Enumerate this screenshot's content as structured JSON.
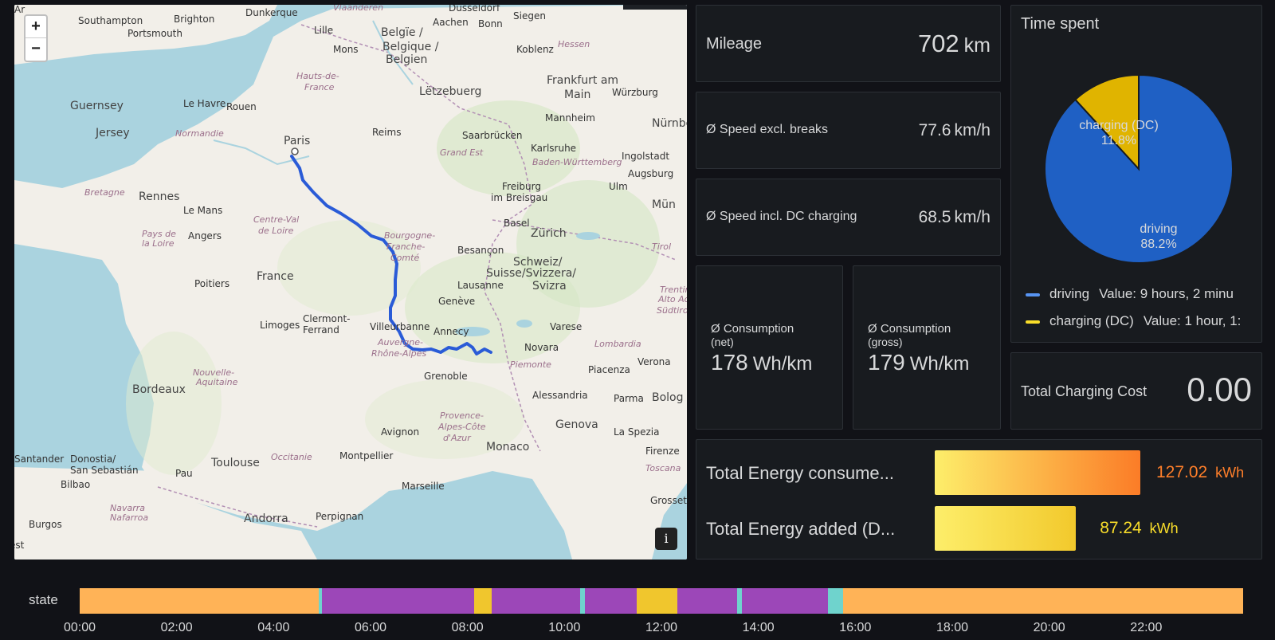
{
  "map": {
    "zoom_in_label": "+",
    "zoom_out_label": "−",
    "info_label": "i",
    "places": [
      {
        "name": "Southampton",
        "cls": ""
      },
      {
        "name": "Brighton",
        "cls": ""
      },
      {
        "name": "Portsmouth",
        "cls": ""
      },
      {
        "name": "Dunkerque",
        "cls": ""
      },
      {
        "name": "Vlaanderen",
        "cls": "region"
      },
      {
        "name": "Düsseldorf",
        "cls": ""
      },
      {
        "name": "Siegen",
        "cls": ""
      },
      {
        "name": "Hessen",
        "cls": "region"
      },
      {
        "name": "Lille",
        "cls": ""
      },
      {
        "name": "Aachen",
        "cls": ""
      },
      {
        "name": "Bonn",
        "cls": ""
      },
      {
        "name": "Mons",
        "cls": ""
      },
      {
        "name": "Belgïe /",
        "cls": "big"
      },
      {
        "name": "Belgique /",
        "cls": "big"
      },
      {
        "name": "Belgien",
        "cls": "big"
      },
      {
        "name": "Koblenz",
        "cls": ""
      },
      {
        "name": "Würzburg",
        "cls": ""
      },
      {
        "name": "Frankfurt am",
        "cls": "big"
      },
      {
        "name": "Main",
        "cls": "big"
      },
      {
        "name": "Guernsey",
        "cls": "big"
      },
      {
        "name": "Le Havre",
        "cls": ""
      },
      {
        "name": "Rouen",
        "cls": ""
      },
      {
        "name": "Hauts-de-",
        "cls": "region"
      },
      {
        "name": "France",
        "cls": "region"
      },
      {
        "name": "Lëtzebuerg",
        "cls": "big"
      },
      {
        "name": "Mannheim",
        "cls": ""
      },
      {
        "name": "Nürnber",
        "cls": "big"
      },
      {
        "name": "Jersey",
        "cls": "big"
      },
      {
        "name": "Normandie",
        "cls": "region"
      },
      {
        "name": "Paris",
        "cls": "big"
      },
      {
        "name": "Reims",
        "cls": ""
      },
      {
        "name": "Saarbrücken",
        "cls": ""
      },
      {
        "name": "Karlsruhe",
        "cls": ""
      },
      {
        "name": "Ingolstadt",
        "cls": ""
      },
      {
        "name": "Grand Est",
        "cls": "region"
      },
      {
        "name": "Baden-Württemberg",
        "cls": "region"
      },
      {
        "name": "Augsburg",
        "cls": ""
      },
      {
        "name": "Bretagne",
        "cls": "region"
      },
      {
        "name": "Rennes",
        "cls": "big"
      },
      {
        "name": "Freiburg",
        "cls": ""
      },
      {
        "name": "im Breisgau",
        "cls": ""
      },
      {
        "name": "Ulm",
        "cls": ""
      },
      {
        "name": "Mün",
        "cls": "big"
      },
      {
        "name": "Le Mans",
        "cls": ""
      },
      {
        "name": "Centre-Val",
        "cls": "region"
      },
      {
        "name": "de Loire",
        "cls": "region"
      },
      {
        "name": "Pays de",
        "cls": "region"
      },
      {
        "name": "la Loire",
        "cls": "region"
      },
      {
        "name": "Angers",
        "cls": ""
      },
      {
        "name": "Bourgogne-",
        "cls": "region"
      },
      {
        "name": "Franche-",
        "cls": "region"
      },
      {
        "name": "Comté",
        "cls": "region"
      },
      {
        "name": "Basel",
        "cls": ""
      },
      {
        "name": "Zürich",
        "cls": "big"
      },
      {
        "name": "Besançon",
        "cls": ""
      },
      {
        "name": "Schweiz/",
        "cls": "big"
      },
      {
        "name": "Suisse/Svizzera/",
        "cls": "big"
      },
      {
        "name": "Svizra",
        "cls": "big"
      },
      {
        "name": "Tirol",
        "cls": "region"
      },
      {
        "name": "Poitiers",
        "cls": ""
      },
      {
        "name": "France",
        "cls": "big"
      },
      {
        "name": "Lausanne",
        "cls": ""
      },
      {
        "name": "Trentino-",
        "cls": "region"
      },
      {
        "name": "Alto Adige",
        "cls": "region"
      },
      {
        "name": "Südtirol",
        "cls": "region"
      },
      {
        "name": "Genève",
        "cls": ""
      },
      {
        "name": "Limoges",
        "cls": ""
      },
      {
        "name": "Clermont-",
        "cls": ""
      },
      {
        "name": "Ferrand",
        "cls": ""
      },
      {
        "name": "Villeurbanne",
        "cls": ""
      },
      {
        "name": "Annecy",
        "cls": ""
      },
      {
        "name": "Varese",
        "cls": ""
      },
      {
        "name": "Lombardia",
        "cls": "region"
      },
      {
        "name": "Auvergne-",
        "cls": "region"
      },
      {
        "name": "Rhône-Alpes",
        "cls": "region"
      },
      {
        "name": "Novara",
        "cls": ""
      },
      {
        "name": "Verona",
        "cls": ""
      },
      {
        "name": "Piemonte",
        "cls": "region"
      },
      {
        "name": "Piacenza",
        "cls": ""
      },
      {
        "name": "Nouvelle-",
        "cls": "region"
      },
      {
        "name": "Aquitaine",
        "cls": "region"
      },
      {
        "name": "Grenoble",
        "cls": ""
      },
      {
        "name": "Bordeaux",
        "cls": "big"
      },
      {
        "name": "Alessandria",
        "cls": ""
      },
      {
        "name": "Parma",
        "cls": ""
      },
      {
        "name": "Bolog",
        "cls": "big"
      },
      {
        "name": "Provence-",
        "cls": "region"
      },
      {
        "name": "Alpes-Côte",
        "cls": "region"
      },
      {
        "name": "d'Azur",
        "cls": "region"
      },
      {
        "name": "Genova",
        "cls": "big"
      },
      {
        "name": "Avignon",
        "cls": ""
      },
      {
        "name": "La Spezia",
        "cls": ""
      },
      {
        "name": "Santander",
        "cls": ""
      },
      {
        "name": "Donostia/",
        "cls": ""
      },
      {
        "name": "San Sebastián",
        "cls": ""
      },
      {
        "name": "Toulouse",
        "cls": "big"
      },
      {
        "name": "Occitanie",
        "cls": "region"
      },
      {
        "name": "Montpellier",
        "cls": ""
      },
      {
        "name": "Monaco",
        "cls": "big"
      },
      {
        "name": "Firenze",
        "cls": ""
      },
      {
        "name": "Pau",
        "cls": ""
      },
      {
        "name": "Toscana",
        "cls": "region"
      },
      {
        "name": "Bilbao",
        "cls": ""
      },
      {
        "name": "Marseille",
        "cls": ""
      },
      {
        "name": "Grosseto",
        "cls": ""
      },
      {
        "name": "Navarra",
        "cls": "region"
      },
      {
        "name": "Nafarroa",
        "cls": "region"
      },
      {
        "name": "Andorra",
        "cls": "big"
      },
      {
        "name": "Perpignan",
        "cls": ""
      },
      {
        "name": "Burgos",
        "cls": ""
      },
      {
        "name": "est",
        "cls": ""
      },
      {
        "name": "Ar",
        "cls": ""
      }
    ]
  },
  "mileage": {
    "label": "Mileage",
    "value": "702",
    "unit": "km"
  },
  "speed_excl": {
    "label": "Ø Speed excl. breaks",
    "value": "77.6",
    "unit": "km/h"
  },
  "speed_incl": {
    "label": "Ø Speed incl. DC charging",
    "value": "68.5",
    "unit": "km/h"
  },
  "consumption_net": {
    "label_line1": "Ø Consumption",
    "label_line2": "(net)",
    "value": "178",
    "unit": "Wh/km"
  },
  "consumption_gross": {
    "label_line1": "Ø Consumption",
    "label_line2": "(gross)",
    "value": "179",
    "unit": "Wh/km"
  },
  "time_spent": {
    "title": "Time spent",
    "slices": [
      {
        "name": "driving",
        "percent_label": "88.2%",
        "fraction": 0.882,
        "color": "#1f60c4"
      },
      {
        "name": "charging (DC)",
        "percent_label": "11.8%",
        "fraction": 0.118,
        "color": "#e0b400"
      }
    ],
    "legend": [
      {
        "name": "driving",
        "value": "Value: 9 hours, 2 minu",
        "color": "#5794f2"
      },
      {
        "name": "charging (DC)",
        "value": "Value: 1 hour, 1:",
        "color": "#fade2a"
      }
    ]
  },
  "charging_cost": {
    "label": "Total Charging Cost",
    "value": "0.00"
  },
  "energy": {
    "consumed": {
      "label": "Total Energy consume...",
      "value": "127.02",
      "unit": "kWh",
      "fraction": 0.645,
      "color": "#ff7f2a",
      "gradient_start": "#fdee6a",
      "gradient_end": "#fb7c27"
    },
    "added": {
      "label": "Total Energy added (D...",
      "value": "87.24",
      "unit": "kWh",
      "fraction": 0.443,
      "color": "#fade2a",
      "gradient_start": "#fdee6a",
      "gradient_end": "#f2c92c"
    }
  },
  "state": {
    "label": "state",
    "colors": {
      "offline": "#ffb357",
      "charging": "#8ab8ff",
      "driving": "#9c47b8",
      "dc": "#f0c62d",
      "online": "#6fd3cd"
    },
    "segments": [
      {
        "state": "offline",
        "from": 0.0,
        "to": 0.2055
      },
      {
        "state": "online",
        "from": 0.2055,
        "to": 0.2085
      },
      {
        "state": "driving",
        "from": 0.2085,
        "to": 0.339
      },
      {
        "state": "dc",
        "from": 0.339,
        "to": 0.354
      },
      {
        "state": "driving",
        "from": 0.354,
        "to": 0.43
      },
      {
        "state": "online",
        "from": 0.43,
        "to": 0.434
      },
      {
        "state": "driving",
        "from": 0.434,
        "to": 0.479
      },
      {
        "state": "dc",
        "from": 0.479,
        "to": 0.514
      },
      {
        "state": "driving",
        "from": 0.514,
        "to": 0.565
      },
      {
        "state": "online",
        "from": 0.565,
        "to": 0.569
      },
      {
        "state": "driving",
        "from": 0.569,
        "to": 0.643
      },
      {
        "state": "online",
        "from": 0.643,
        "to": 0.656
      },
      {
        "state": "offline",
        "from": 0.656,
        "to": 1.0
      }
    ],
    "ticks": [
      "00:00",
      "02:00",
      "04:00",
      "06:00",
      "08:00",
      "10:00",
      "12:00",
      "14:00",
      "16:00",
      "18:00",
      "20:00",
      "22:00"
    ]
  }
}
